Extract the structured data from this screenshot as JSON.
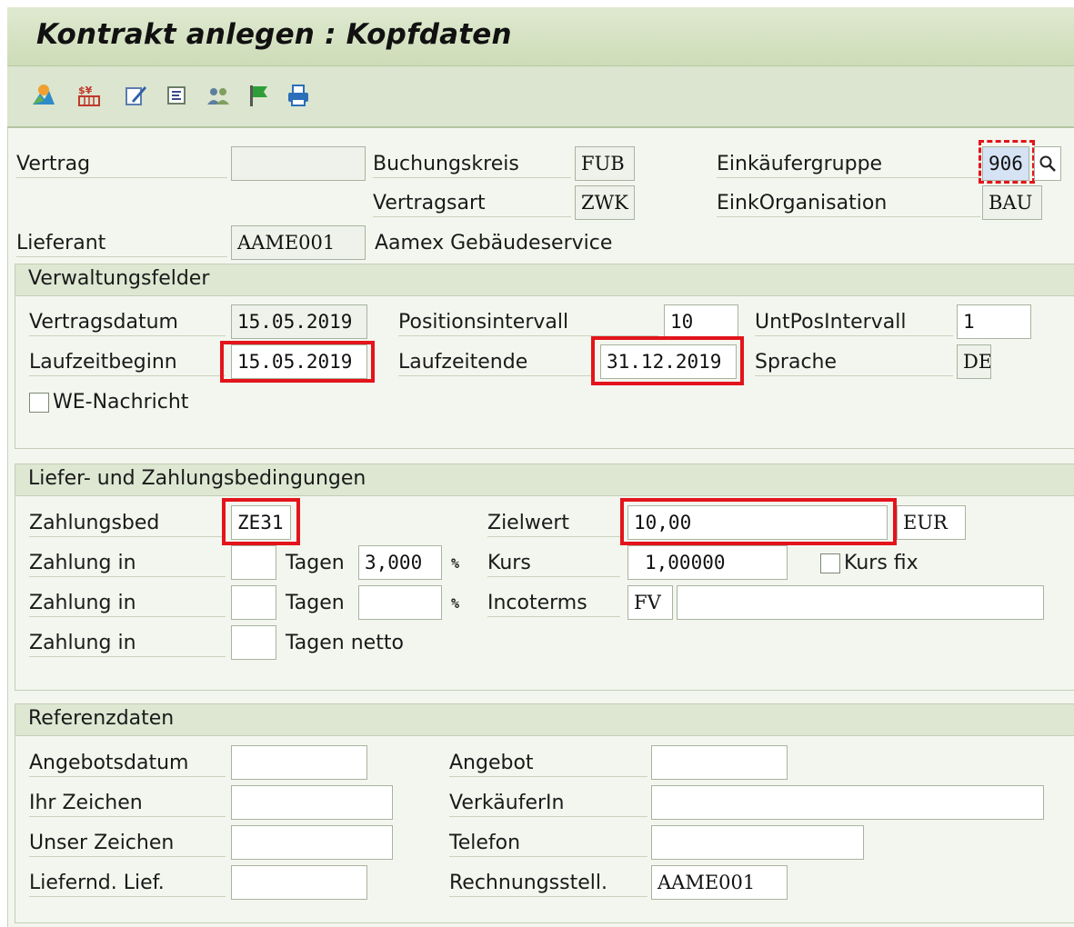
{
  "window": {
    "title": "Kontrakt anlegen : Kopfdaten"
  },
  "toolbar": {
    "icons": [
      "header-overview-icon",
      "conditions-icon",
      "edit-texts-icon",
      "details-icon",
      "partners-icon",
      "status-flag-icon",
      "print-icon"
    ]
  },
  "header": {
    "vertrag_label": "Vertrag",
    "vertrag_value": "",
    "buchungskreis_label": "Buchungskreis",
    "buchungskreis_value": "FUB",
    "vertragsart_label": "Vertragsart",
    "vertragsart_value": "ZWK",
    "einkaeufergruppe_label": "Einkäufergruppe",
    "einkaeufergruppe_value": "906",
    "einkorganisation_label": "EinkOrganisation",
    "einkorganisation_value": "BAU",
    "lieferant_label": "Lieferant",
    "lieferant_value": "AAME001",
    "lieferant_name": "Aamex Gebäudeservice"
  },
  "verwaltung": {
    "title": "Verwaltungsfelder",
    "vertragsdatum_label": "Vertragsdatum",
    "vertragsdatum_value": "15.05.2019",
    "positionsintervall_label": "Positionsintervall",
    "positionsintervall_value": "10",
    "untposintervall_label": "UntPosIntervall",
    "untposintervall_value": "1",
    "laufzeitbeginn_label": "Laufzeitbeginn",
    "laufzeitbeginn_value": "15.05.2019",
    "laufzeitende_label": "Laufzeitende",
    "laufzeitende_value": "31.12.2019",
    "sprache_label": "Sprache",
    "sprache_value": "DE",
    "we_nachricht_label": "WE-Nachricht"
  },
  "liefer": {
    "title": "Liefer- und Zahlungsbedingungen",
    "zahlungsbed_label": "Zahlungsbed",
    "zahlungsbed_value": "ZE31",
    "zielwert_label": "Zielwert",
    "zielwert_value": "10,00",
    "waehrung_value": "EUR",
    "zahlung_in_label": "Zahlung in",
    "tagen_label": "Tagen",
    "tagen_netto_label": "Tagen netto",
    "pct_symbol": "%",
    "zahlung1_days": "",
    "zahlung1_pct": "3,000",
    "zahlung2_days": "",
    "zahlung2_pct": "",
    "zahlung3_days": "",
    "kurs_label": "Kurs",
    "kurs_value": "1,00000",
    "kurs_fix_label": "Kurs fix",
    "incoterms_label": "Incoterms",
    "incoterms_value": "FV",
    "incoterms_text": ""
  },
  "referenz": {
    "title": "Referenzdaten",
    "angebotsdatum_label": "Angebotsdatum",
    "angebotsdatum_value": "",
    "angebot_label": "Angebot",
    "angebot_value": "",
    "ihr_zeichen_label": "Ihr Zeichen",
    "ihr_zeichen_value": "",
    "verkaeuferin_label": "VerkäuferIn",
    "verkaeuferin_value": "",
    "unser_zeichen_label": "Unser Zeichen",
    "unser_zeichen_value": "",
    "telefon_label": "Telefon",
    "telefon_value": "",
    "liefernd_lief_label": "Liefernd. Lief.",
    "liefernd_lief_value": "",
    "rechnungsstell_label": "Rechnungsstell.",
    "rechnungsstell_value": "AAME001"
  },
  "colors": {
    "highlight": "#e3141b",
    "title_bg": "#cddcb8",
    "panel_bg": "#f3f6ee"
  }
}
